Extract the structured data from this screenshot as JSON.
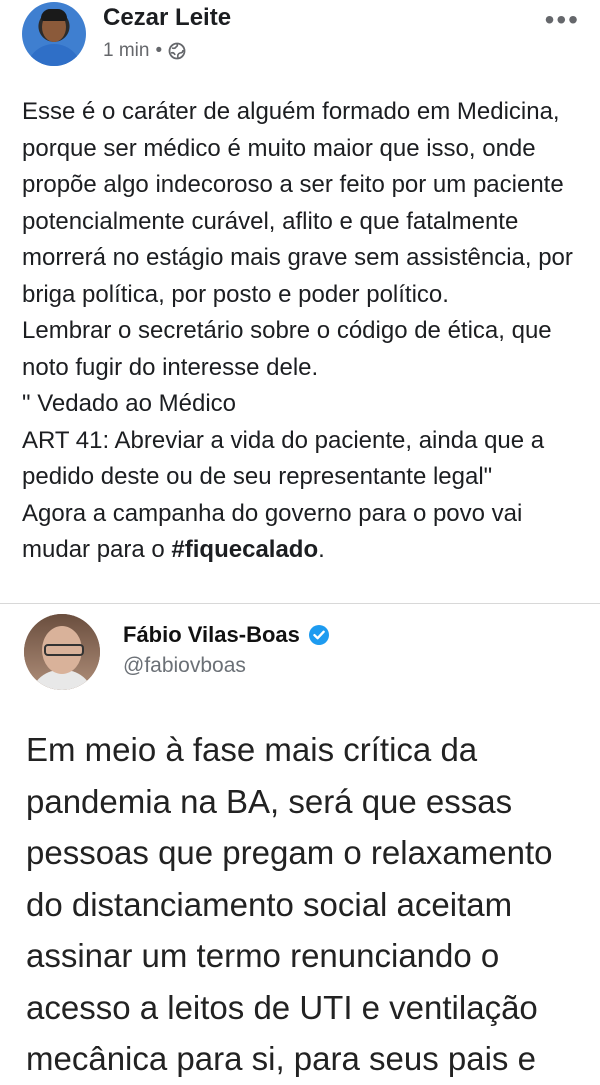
{
  "post": {
    "author": "Cezar Leite",
    "time": "1 min",
    "separator": "•",
    "text_lines": [
      "Esse é o caráter de alguém formado em Medicina, porque ser médico é muito maior que isso, onde propõe algo indecoroso a ser feito por um paciente potencialmente curável, aflito e que fatalmente morrerá no estágio mais grave sem assistência, por briga política, por posto e poder político.",
      "Lembrar o secretário sobre o código de ética, que noto fugir do interesse dele.",
      "\" Vedado ao Médico",
      "ART 41: Abreviar a vida do paciente, ainda que a pedido deste ou de seu representante legal\"",
      "Agora a campanha do governo para o povo vai mudar para o "
    ],
    "hashtag": "#fiquecalado",
    "trailing": "."
  },
  "tweet": {
    "name": "Fábio Vilas-Boas",
    "handle": "@fabiovboas",
    "text": "Em meio à fase mais crítica da\npandemia na BA, será que essas\npessoas que pregam o relaxamento\ndo distanciamento social aceitam\nassinar um termo renunciando o\nacesso a leitos de UTI e ventilação\nmecânica para si, para seus pais e"
  },
  "icons": {
    "more": "more-icon",
    "globe": "globe-icon",
    "verified": "verified-icon"
  },
  "colors": {
    "verified": "#1d9bf0",
    "meta_text": "#65676b"
  }
}
